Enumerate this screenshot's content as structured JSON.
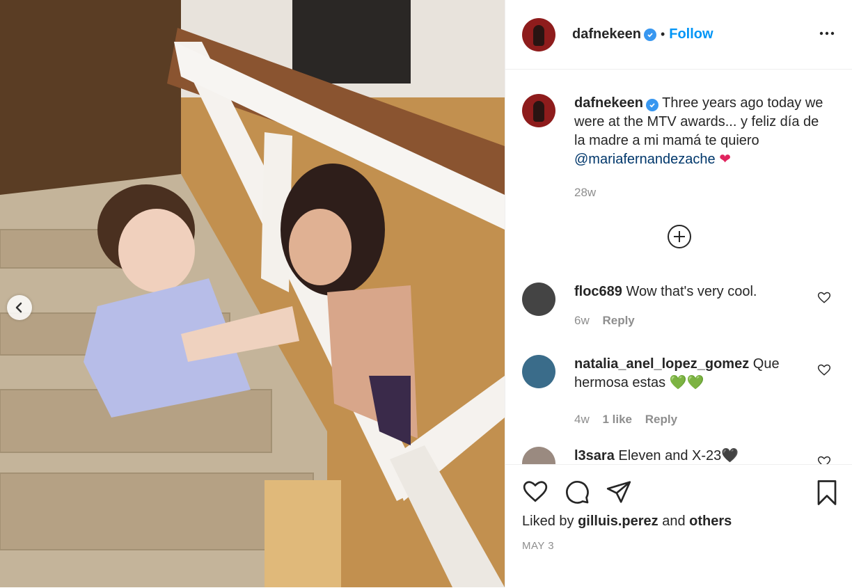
{
  "header": {
    "username": "dafnekeen",
    "separator": "•",
    "follow_label": "Follow",
    "more_icon": "more-options-icon"
  },
  "caption": {
    "username": "dafnekeen",
    "text": "Three years ago today we were at the MTV awards... y feliz día de la madre a mi mamá te quiero",
    "mention": "@mariafernandezache",
    "emoji": "❤",
    "time": "28w"
  },
  "comments": [
    {
      "username": "floc689",
      "text": "Wow that's very cool.",
      "time": "6w",
      "likes": "",
      "reply_label": "Reply"
    },
    {
      "username": "natalia_anel_lopez_gomez",
      "text": "Que hermosa estas",
      "emoji": "💚💚",
      "time": "4w",
      "likes": "1 like",
      "reply_label": "Reply"
    },
    {
      "username": "l3sara",
      "text": "Eleven and X-23",
      "emoji": "🖤"
    }
  ],
  "actions": {
    "liked_prefix": "Liked by",
    "liked_user": "gilluis.perez",
    "liked_and": "and",
    "liked_others": "others",
    "date": "MAY 3"
  },
  "colors": {
    "accent": "#0095f6",
    "verified": "#3897f0",
    "muted": "#8e8e8e",
    "mention": "#00376b"
  }
}
